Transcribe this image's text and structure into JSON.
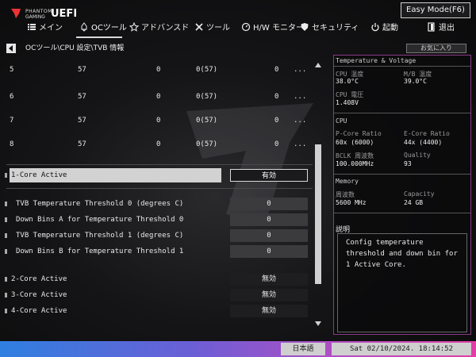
{
  "header": {
    "brand_line1": "PHANTOM",
    "brand_line2": "GAMING",
    "brand_product": "UEFI",
    "easy_mode_label": "Easy Mode(F6)"
  },
  "nav": {
    "items": [
      {
        "label": "メイン",
        "icon": "list-icon"
      },
      {
        "label": "OCツール",
        "icon": "rocket-icon"
      },
      {
        "label": "アドバンスド",
        "icon": "star-icon"
      },
      {
        "label": "ツール",
        "icon": "tools-icon"
      },
      {
        "label": "H/W モニター",
        "icon": "monitor-icon"
      },
      {
        "label": "セキュリティ",
        "icon": "shield-icon"
      },
      {
        "label": "起動",
        "icon": "power-icon"
      },
      {
        "label": "退出",
        "icon": "exit-icon"
      }
    ],
    "active_index": 1
  },
  "breadcrumb": "OCツール\\CPU 設定\\TVB 情報",
  "favorites_label": "お気に入り",
  "table_rows": [
    {
      "c1": "5",
      "c2": "57",
      "c3": "0",
      "c4": "0(57)",
      "c5": "0",
      "c6": "..."
    },
    {
      "c1": "6",
      "c2": "57",
      "c3": "0",
      "c4": "0(57)",
      "c5": "0",
      "c6": "..."
    },
    {
      "c1": "7",
      "c2": "57",
      "c3": "0",
      "c4": "0(57)",
      "c5": "0",
      "c6": "..."
    },
    {
      "c1": "8",
      "c2": "57",
      "c3": "0",
      "c4": "0(57)",
      "c5": "0",
      "c6": "..."
    }
  ],
  "settings": {
    "core1": {
      "label": "1-Core Active",
      "value": "有効"
    },
    "tvb_thr0": {
      "label": "TVB Temperature Threshold 0 (degrees C)",
      "value": "0"
    },
    "down_a": {
      "label": "Down Bins A for Temperature Threshold 0",
      "value": "0"
    },
    "tvb_thr1": {
      "label": "TVB Temperature Threshold 1 (degrees C)",
      "value": "0"
    },
    "down_b": {
      "label": "Down Bins B for Temperature Threshold 1",
      "value": "0"
    },
    "core2": {
      "label": "2-Core Active",
      "value": "無効"
    },
    "core3": {
      "label": "3-Core Active",
      "value": "無効"
    },
    "core4": {
      "label": "4-Core Active",
      "value": "無効"
    }
  },
  "right_panel": {
    "temp_heading": "Temperature & Voltage",
    "cpu_temp_label": "CPU 温度",
    "cpu_temp_value": "38.0°C",
    "mb_temp_label": "M/B 温度",
    "mb_temp_value": "39.0°C",
    "cpu_volt_label": "CPU 電圧",
    "cpu_volt_value": "1.408V",
    "cpu_heading": "CPU",
    "pcore_label": "P-Core Ratio",
    "pcore_value": "60x (6000)",
    "ecore_label": "E-Core Ratio",
    "ecore_value": "44x (4400)",
    "bclk_label": "BCLK 周波数",
    "bclk_value": "100.000MHz",
    "quality_label": "Quality",
    "quality_value": "93",
    "mem_heading": "Memory",
    "freq_label": "周波数",
    "freq_value": "5600 MHz",
    "cap_label": "Capacity",
    "cap_value": "24 GB",
    "desc_heading": "説明",
    "desc_text": "Config temperature threshold and down bin for 1 Active Core."
  },
  "footer": {
    "language": "日本語",
    "datetime": "Sat 02/10/2024. 18:14:52"
  }
}
